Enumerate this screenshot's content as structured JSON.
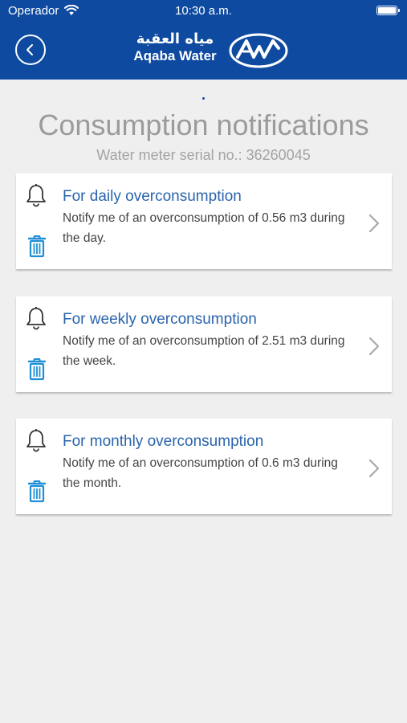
{
  "status_bar": {
    "carrier": "Operador",
    "time": "10:30 a.m."
  },
  "header": {
    "logo_arabic": "مياه العقبة",
    "logo_english": "Aqaba Water",
    "colors": {
      "brand_blue": "#0d4aa0"
    }
  },
  "page": {
    "title": "Consumption notifications",
    "subtitle": "Water meter serial no.: 36260045"
  },
  "notifications": [
    {
      "title": "For daily overconsumption",
      "description": "Notify me of an overconsumption of 0.56 m3 during the day."
    },
    {
      "title": "For weekly overconsumption",
      "description": "Notify me of an overconsumption of 2.51 m3 during the week."
    },
    {
      "title": "For monthly overconsumption",
      "description": "Notify me of an overconsumption of 0.6 m3 during the month."
    }
  ],
  "icons": {
    "back": "chevron-left-icon",
    "bell": "bell-icon",
    "delete": "trash-icon",
    "open": "chevron-right-icon",
    "logo": "aqaba-water-logo"
  }
}
